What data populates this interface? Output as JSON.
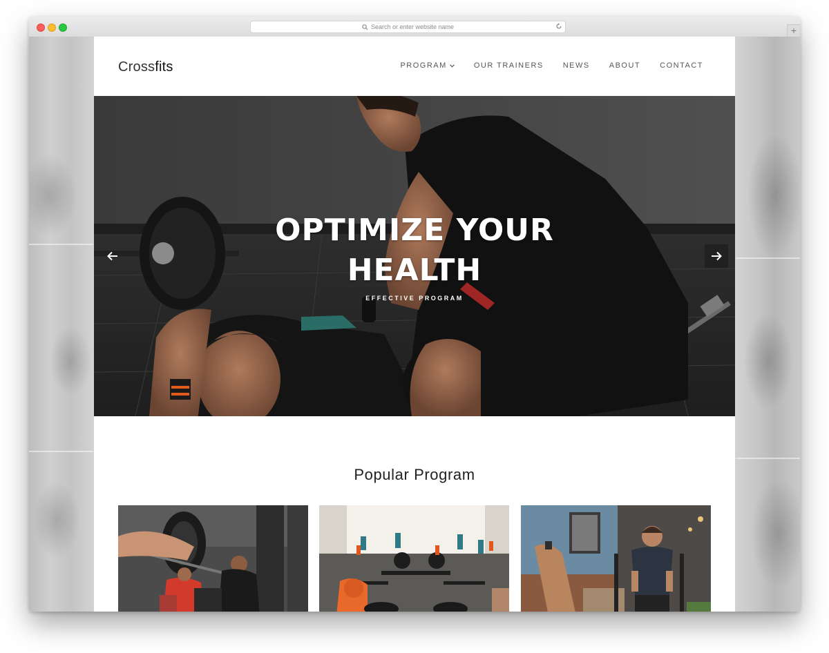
{
  "browser": {
    "url_placeholder": "Search or enter website name",
    "new_tab_label": "+"
  },
  "site": {
    "logo": {
      "part1": "Cross",
      "part2": "fits"
    },
    "nav": [
      {
        "label": "PROGRAM",
        "has_dropdown": true
      },
      {
        "label": "OUR TRAINERS"
      },
      {
        "label": "NEWS"
      },
      {
        "label": "ABOUT"
      },
      {
        "label": "CONTACT"
      }
    ],
    "hero": {
      "title_line1": "OPTIMIZE YOUR",
      "title_line2": "HEALTH",
      "subtitle": "EFFECTIVE PROGRAM"
    },
    "popular": {
      "title": "Popular Program",
      "cards": [
        {
          "image": "weightlifting-spotting-photo"
        },
        {
          "image": "group-rowing-class-photo"
        },
        {
          "image": "sled-push-trainer-photo"
        }
      ]
    }
  },
  "colors": {
    "text_dark": "#222222",
    "nav_text": "#555555",
    "hero_text": "#ffffff"
  }
}
